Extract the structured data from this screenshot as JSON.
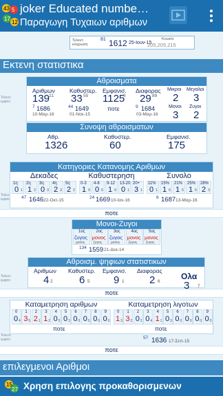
{
  "header": {
    "title": "joker Educated numbe…",
    "subtitle": "Παραγωγη Τυχαιων αριθμων",
    "logo_numbers": [
      "43",
      "5",
      "17",
      "12"
    ]
  },
  "last_draw": {
    "label": "Τελευτ. κληρωση",
    "super_number": "81",
    "draw_id": "1612",
    "date": "25-Ιουν-15",
    "jackpot_label": "Κουκ/α",
    "jackpot_value": "205,205,215"
  },
  "section_title": "Εκτενη στατιστικα",
  "sums": {
    "title": "Αθροισματα",
    "side_label": "Τελευτ. εμφαν.",
    "arithmon": {
      "label": "Αριθμων",
      "value": "139",
      "sup": "21",
      "draw_sup": "7",
      "draw": "1686",
      "date": "10-Μαρ-16"
    },
    "kathyster": {
      "label": "Καθυστερ.",
      "value": "33",
      "sup": "55",
      "draw_sup": "44",
      "draw": "1649",
      "date": "01-Νοε-15"
    },
    "emfanis": {
      "label": "Εμφανισ.",
      "value": "1125",
      "sup": "6",
      "never": "ποτε"
    },
    "diafores": {
      "label": "Διαφορας",
      "value": "29",
      "sup": "89",
      "draw_sup": "9",
      "draw": "1684",
      "date": "03-Μαρ-16"
    },
    "mikroi": {
      "label": "Μικροι",
      "value": "2"
    },
    "megaloi": {
      "label": "Μεγαλοι",
      "value": "3"
    },
    "monoi": {
      "label": "Μονοι",
      "value": "3"
    },
    "zygoi": {
      "label": "Ζυγοι",
      "value": "2"
    }
  },
  "sum_summary": {
    "title": "Συνοψη αθροισματων",
    "athr_label": "Αθρ.",
    "athr_value": "1326",
    "kath_label": "Καθυστερ.",
    "kath_value": "60",
    "emf_label": "Εμφανισ.",
    "emf_value": "175"
  },
  "categories": {
    "title": "Κατηγοριες Κατανομης Αριθμων",
    "side_label": "Τελευτ. εμφαν.",
    "dekades": {
      "title": "Δεκαδες",
      "cells": [
        {
          "l": "1η",
          "v": "0",
          "s": "1"
        },
        {
          "l": "2η",
          "v": "1",
          "s": "2"
        },
        {
          "l": "3η",
          "v": "0",
          "s": "3"
        },
        {
          "l": "4η",
          "v": "2",
          "s": "3"
        },
        {
          "l": "5η",
          "v": "2",
          "s": "2"
        }
      ],
      "draw_sup": "47",
      "draw": "1646",
      "date": "22-Οκτ-15"
    },
    "kathysterisi": {
      "title": "Καθυστερηση",
      "cells": [
        {
          "l": "0-3",
          "v": "1",
          "s": "9"
        },
        {
          "l": "4-8",
          "v": "0",
          "s": "6"
        },
        {
          "l": "9-12",
          "v": "1",
          "s": "0"
        },
        {
          "l": "13-20",
          "v": "0",
          "s": "1"
        },
        {
          "l": "20+",
          "v": "3",
          "s": "1"
        }
      ],
      "draw_sup": "24",
      "draw": "1669",
      "date": "10-Ιαν-16"
    },
    "synolo": {
      "title": "Συνολο",
      "cells": [
        {
          "l": "11%",
          "v": "0",
          "s": "1"
        },
        {
          "l": "15%",
          "v": "1",
          "s": "6"
        },
        {
          "l": "21%",
          "v": "1",
          "s": "5"
        },
        {
          "l": "25%",
          "v": "1",
          "s": "6"
        },
        {
          "l": "28%",
          "v": "2",
          "s": "3"
        }
      ],
      "draw_sup": "6",
      "draw": "1687",
      "date": "13-Μαρ-16"
    },
    "never": "ποτε"
  },
  "odd_even": {
    "title": "Μονοι-Ζυγοι",
    "labels": [
      "1ος",
      "2ος",
      "3ος",
      "4ος",
      "5ος"
    ],
    "values": [
      "ζυγος",
      "μονος",
      "ζυγος",
      "μονος",
      "μονος"
    ],
    "subs": [
      "μονος",
      "ζυγος",
      "μονος",
      "ζυγος",
      "ζυγος"
    ],
    "draw_sup": "134",
    "draw": "1559",
    "date": "21-Δεκ-14"
  },
  "digits": {
    "title": "Αθροισμ. ψηφιων στατιστικων",
    "side_label": "Τελευτ. εμφαν.",
    "arithmon": {
      "label": "Αριθμων",
      "value": "4",
      "sup": "2"
    },
    "kathyster": {
      "label": "Καθυστερ.",
      "value": "6",
      "sup": "5"
    },
    "emfanis": {
      "label": "Εμφανισ.",
      "value": "9",
      "sup": "1"
    },
    "diaforas": {
      "label": "Διαφορας",
      "value": "2",
      "sup": "6"
    },
    "ola_label": "Ολα",
    "ola_value": "3",
    "ola_sup": "7",
    "never": "ποτε"
  },
  "counts": {
    "side_label": "Τελευτ. εμφαν.",
    "arithmon_title": "Καταμετρηση αριθμων",
    "ligoton_title": "Καταμετρηση λιγοτων",
    "arithmon": [
      {
        "l": "0",
        "v": "0",
        "s": "4"
      },
      {
        "l": "1",
        "v": "3",
        "s": "5"
      },
      {
        "l": "2",
        "v": "2",
        "s": "1"
      },
      {
        "l": "3",
        "v": "1",
        "s": "2"
      },
      {
        "l": "4",
        "v": "0",
        "s": "5"
      },
      {
        "l": "5",
        "v": "0",
        "s": "3"
      },
      {
        "l": "6",
        "v": "0",
        "s": "0"
      },
      {
        "l": "7",
        "v": "0",
        "s": "0"
      },
      {
        "l": "8",
        "v": "0",
        "s": "0"
      },
      {
        "l": "9",
        "v": "0",
        "s": "0"
      }
    ],
    "ligoton": [
      {
        "l": "0",
        "v": "1",
        "s": "3"
      },
      {
        "l": "1",
        "v": "3",
        "s": "2"
      },
      {
        "l": "2",
        "v": "0",
        "s": "2"
      },
      {
        "l": "3",
        "v": "0",
        "s": "4"
      },
      {
        "l": "4",
        "v": "1",
        "s": "1"
      },
      {
        "l": "5",
        "v": "0",
        "s": "3"
      },
      {
        "l": "6",
        "v": "0",
        "s": "0"
      },
      {
        "l": "7",
        "v": "0",
        "s": "0"
      },
      {
        "l": "8",
        "v": "0",
        "s": "0"
      },
      {
        "l": "9",
        "v": "0",
        "s": "0"
      }
    ],
    "never_a": "ποτε",
    "never_b": "ποτε",
    "draw_sup": "57",
    "draw": "1636",
    "date": "17-Σεπ-15",
    "never_c": "ποτε"
  },
  "selected_title": "επιλεγμενοι Αριθμοι",
  "predefined": {
    "label": "Χρηση επιλογης προκαθορισμενων",
    "logo_numbers": [
      "15",
      "27"
    ]
  }
}
